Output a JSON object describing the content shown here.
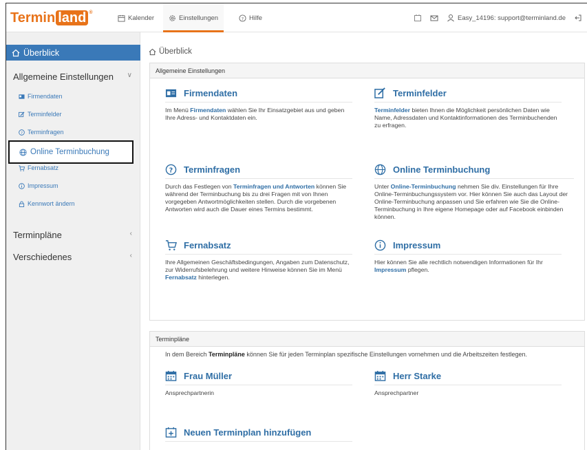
{
  "app": {
    "logo_part1": "Termin",
    "logo_part2": "land",
    "logo_mark": "®"
  },
  "topnav": {
    "items": [
      {
        "label": "Kalender",
        "icon": "calendar-icon"
      },
      {
        "label": "Einstellungen",
        "icon": "gear-icon",
        "active": true
      },
      {
        "label": "Hilfe",
        "icon": "help-icon"
      }
    ],
    "account": "Easy_14196: support@terminland.de"
  },
  "sidebar": {
    "overview": "Überblick",
    "group_general": "Allgemeine Einstellungen",
    "sub_items": [
      {
        "label": "Firmendaten"
      },
      {
        "label": "Terminfelder"
      },
      {
        "label": "Terminfragen"
      },
      {
        "label": "Online Terminbuchung"
      },
      {
        "label": "Fernabsatz"
      },
      {
        "label": "Impressum"
      },
      {
        "label": "Kennwort ändern"
      }
    ],
    "group_plans": "Terminpläne",
    "group_misc": "Verschiedenes"
  },
  "breadcrumb": "Überblick",
  "general_panel": {
    "title": "Allgemeine Einstellungen",
    "cards": {
      "firmendaten": {
        "title": "Firmendaten",
        "t1": "Im Menü ",
        "link": "Firmendaten",
        "t2": " wählen Sie Ihr Einsatzgebiet aus und geben Ihre Adress- und Kontaktdaten ein."
      },
      "terminfelder": {
        "title": "Terminfelder",
        "link": "Terminfelder",
        "t2": " bieten Ihnen die Möglichkeit persönlichen Daten wie Name, Adressdaten und Kontaktinformationen des Terminbuchenden zu erfragen."
      },
      "terminfragen": {
        "title": "Terminfragen",
        "t1": "Durch das Festlegen von ",
        "link": "Terminfragen und Antworten",
        "t2": " können Sie während der Terminbuchung bis zu drei Fragen mit von Ihnen vorgegeben Antwortmöglichkeiten stellen. Durch die vorgebenen Antworten wird auch die Dauer eines Termins bestimmt."
      },
      "online": {
        "title": "Online Terminbuchung",
        "t1": "Unter ",
        "link": "Online-Terminbuchung",
        "t2": " nehmen Sie div. Einstellungen für Ihre Online-Terminbuchungssystem vor. Hier können Sie auch das Layout der Online-Terminbuchung anpassen und Sie erfahren wie Sie die Online-Terminbuchung in Ihre eigene Homepage oder auf Facebook einbinden können."
      },
      "fernabsatz": {
        "title": "Fernabsatz",
        "t1": "Ihre Allgemeinen Geschäftsbedingungen, Angaben zum Datenschutz, zur Widerrufsbelehrung und weitere Hinweise können Sie im Menü ",
        "link": "Fernabsatz",
        "t2": " hinterlegen."
      },
      "impressum": {
        "title": "Impressum",
        "t1": "Hier können Sie alle rechtlich notwendigen Informationen für Ihr ",
        "link": "Impressum",
        "t2": " pflegen."
      }
    }
  },
  "plans_panel": {
    "title": "Terminpläne",
    "intro_1": "In dem Bereich ",
    "intro_bold": "Terminpläne",
    "intro_2": " können Sie für jeden Terminplan spezifische Einstellungen vornehmen und die Arbeitszeiten festlegen.",
    "plans": [
      {
        "name": "Frau Müller",
        "role": "Ansprechpartnerin"
      },
      {
        "name": "Herr Starke",
        "role": "Ansprechpartner"
      }
    ],
    "add_label": "Neuen Terminplan hinzufügen"
  }
}
